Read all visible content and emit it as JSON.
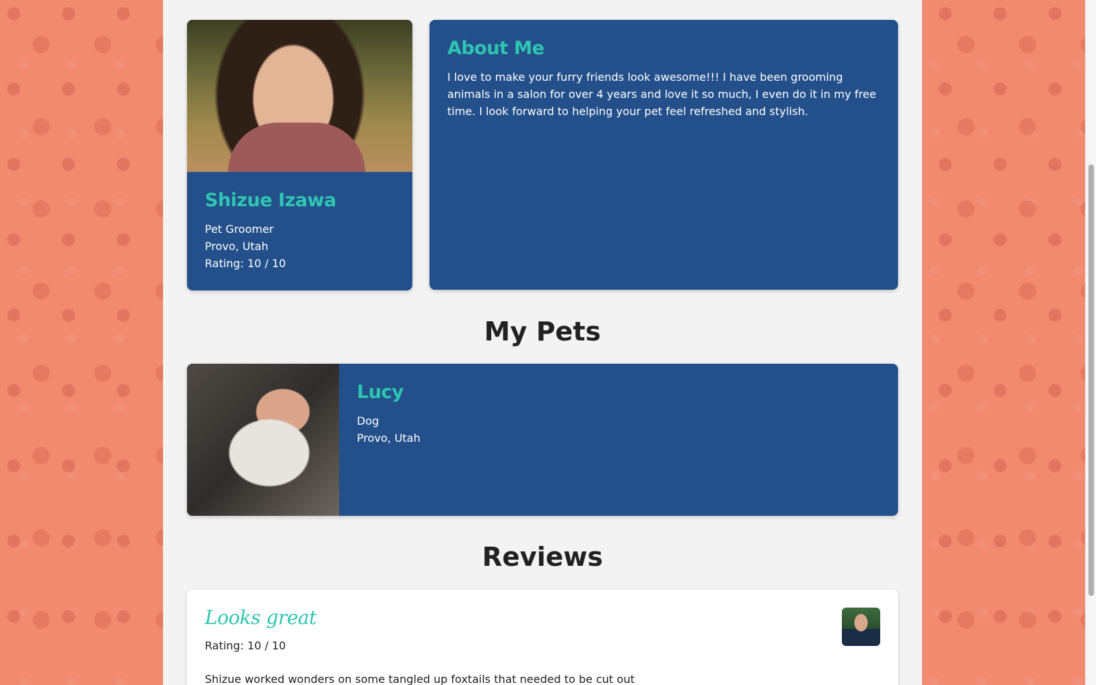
{
  "profile": {
    "name": "Shizue Izawa",
    "role": "Pet Groomer",
    "location": "Provo, Utah",
    "rating": "Rating: 10 / 10"
  },
  "about": {
    "heading": "About Me",
    "text": "I love to make your furry friends look awesome!!! I have been grooming animals in a salon for over 4 years and love it so much, I even do it in my free time. I look forward to helping your pet feel refreshed and stylish."
  },
  "pets_section": {
    "heading": "My Pets",
    "pets": [
      {
        "name": "Lucy",
        "type": "Dog",
        "location": "Provo, Utah"
      }
    ]
  },
  "reviews_section": {
    "heading": "Reviews",
    "reviews": [
      {
        "title": "Looks great",
        "rating": "Rating: 10 / 10",
        "text": "Shizue worked wonders on some tangled up foxtails that needed to be cut out"
      }
    ]
  },
  "colors": {
    "background": "#f28a70",
    "card_blue": "#23508a",
    "accent_teal": "#2fc5b1",
    "page_bg": "#f3f3f3"
  }
}
